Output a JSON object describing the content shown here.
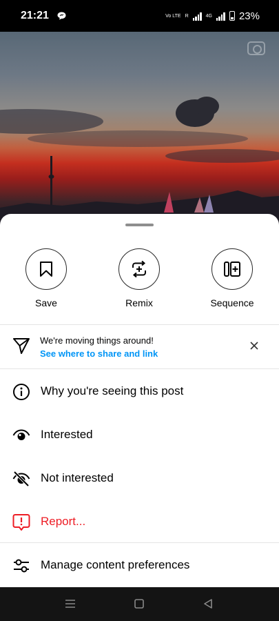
{
  "status_bar": {
    "time": "21:21",
    "volte": "Vo LTE",
    "r_label": "R",
    "net": "4G",
    "battery": "23%"
  },
  "actions": [
    {
      "label": "Save",
      "icon": "bookmark-icon"
    },
    {
      "label": "Remix",
      "icon": "remix-icon"
    },
    {
      "label": "Sequence",
      "icon": "sequence-icon"
    }
  ],
  "notice": {
    "title": "We're moving things around!",
    "link": "See where to share and link"
  },
  "menu": [
    {
      "label": "Why you're seeing this post",
      "icon": "info-icon"
    },
    {
      "label": "Interested",
      "icon": "eye-icon"
    },
    {
      "label": "Not interested",
      "icon": "eye-off-icon"
    },
    {
      "label": "Report...",
      "icon": "report-icon",
      "color": "#ed1c24"
    },
    {
      "label": "Manage content preferences",
      "icon": "sliders-icon"
    }
  ],
  "colors": {
    "link": "#0095f6",
    "danger": "#ed1c24",
    "nav_bar": "#141414"
  }
}
